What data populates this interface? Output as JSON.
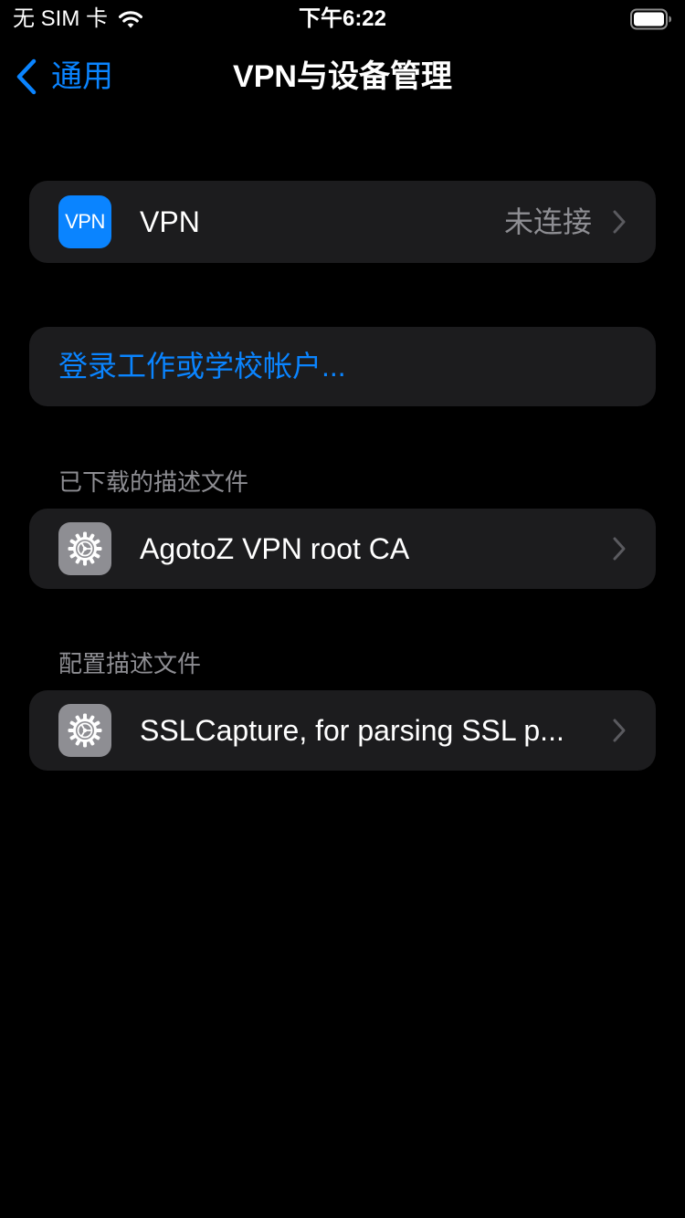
{
  "status_bar": {
    "carrier": "无 SIM 卡",
    "time": "下午6:22",
    "wifi_icon": "wifi-icon",
    "battery_icon": "battery-full-icon"
  },
  "nav": {
    "back_label": "通用",
    "title": "VPN与设备管理"
  },
  "vpn_row": {
    "icon_text": "VPN",
    "label": "VPN",
    "value": "未连接"
  },
  "signin_row": {
    "label": "登录工作或学校帐户..."
  },
  "downloaded_section": {
    "header": "已下载的描述文件",
    "items": [
      {
        "label": "AgotoZ VPN root CA",
        "icon": "settings-gear-icon"
      }
    ]
  },
  "config_section": {
    "header": "配置描述文件",
    "items": [
      {
        "label": "SSLCapture, for parsing SSL p...",
        "icon": "settings-gear-icon"
      }
    ]
  },
  "colors": {
    "background": "#000000",
    "group_background": "#1c1c1e",
    "accent": "#0a84ff",
    "secondary_text": "#8e8e93"
  }
}
